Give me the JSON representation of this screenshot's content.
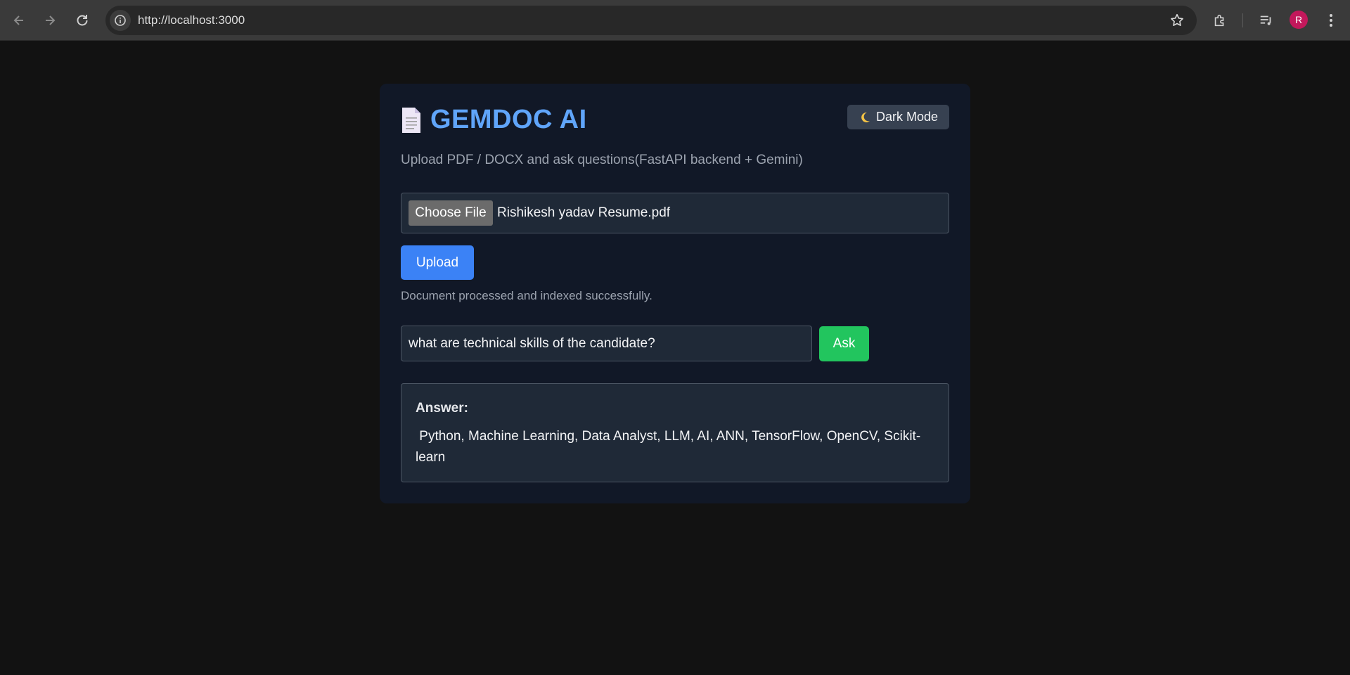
{
  "browser": {
    "url": "http://localhost:3000",
    "profile_initial": "R"
  },
  "header": {
    "title": "GEMDOC AI",
    "mode_button_label": "Dark Mode",
    "subtitle": "Upload PDF / DOCX and ask questions(FastAPI backend + Gemini)"
  },
  "upload": {
    "choose_label": "Choose File",
    "file_name": "Rishikesh yadav Resume.pdf",
    "upload_label": "Upload",
    "status": "Document processed and indexed successfully."
  },
  "ask": {
    "question_value": "what are technical skills of the candidate?",
    "ask_label": "Ask"
  },
  "answer": {
    "label": "Answer:",
    "text": " Python, Machine Learning, Data Analyst, LLM, AI, ANN, TensorFlow, OpenCV, Scikit-learn"
  },
  "colors": {
    "title": "#60a5fa",
    "upload_button": "#3b82f6",
    "ask_button": "#22c55e",
    "card_bg": "#111827"
  }
}
